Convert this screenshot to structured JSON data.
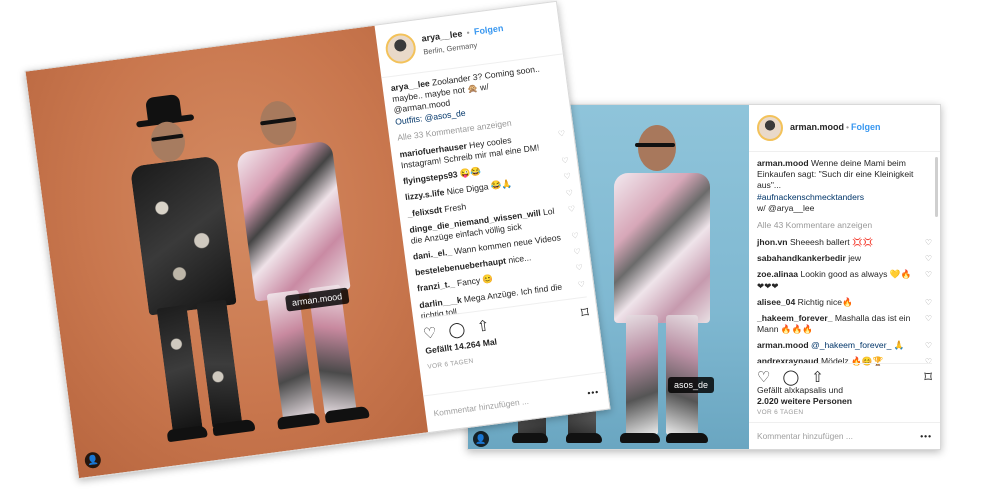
{
  "post2": {
    "username": "arman.mood",
    "follow": "Folgen",
    "dot": "•",
    "photo_tag": "asos_de",
    "comments": [
      {
        "user": "arman.mood",
        "text": "Wenne deine Mami beim Einkaufen sagt: \"Such dir eine Kleinigkeit aus\"..."
      },
      {
        "user": "",
        "text": "#aufnackenschmecktanders"
      },
      {
        "user": "",
        "text": "w/ @arya__lee"
      }
    ],
    "view_all": "Alle 43 Kommentare anzeigen",
    "replies": [
      {
        "user": "jhon.vn",
        "text": "Sheeesh ballert 💢💢"
      },
      {
        "user": "sabahandkankerbedir",
        "text": "jew"
      },
      {
        "user": "zoe.alinaa",
        "text": "Lookin good as always 💛🔥❤❤❤"
      },
      {
        "user": "alisee_04",
        "text": "Richtig nice🔥"
      },
      {
        "user": "_hakeem_forever_",
        "text": "Mashalla das ist ein Mann 🔥🔥🔥"
      },
      {
        "user": "arman.mood",
        "text": "@_hakeem_forever_ 🙏"
      },
      {
        "user": "andrexraynaud",
        "text": "Mödelz 🔥😊🏆"
      }
    ],
    "likes_line1": "Gefällt alxkapsalis und",
    "likes_line2": "2.020 weitere Personen",
    "timestamp": "VOR 6 TAGEN",
    "add_comment": "Kommentar hinzufügen ...",
    "options": "•••"
  },
  "post1": {
    "username": "arya__lee",
    "follow": "Folgen",
    "dot": "•",
    "location": "Berlin, Germany",
    "photo_tag": "arman.mood",
    "caption_user": "arya__lee",
    "caption_text": "Zoolander 3? Coming soon.. maybe.. maybe not 🙊 w/ @arman.mood",
    "caption_outfits": "Outfits: @asos_de",
    "view_all": "Alle 33 Kommentare anzeigen",
    "replies": [
      {
        "user": "mariofuerhauser",
        "text": "Hey cooles Instagram! Schreib mir mal eine DM!"
      },
      {
        "user": "flyingsteps93",
        "text": "😜😂"
      },
      {
        "user": "lizzy.s.life",
        "text": "Nice Digga 😂🙏"
      },
      {
        "user": "_felixsdt",
        "text": "Fresh"
      },
      {
        "user": "dinge_die_niemand_wissen_will",
        "text": "Lol die Anzüge einfach völlig sick"
      },
      {
        "user": "dani._el._",
        "text": "Wann kommen neue Videos"
      },
      {
        "user": "bestelebenueberhaupt",
        "text": "nice..."
      },
      {
        "user": "franzi_t._",
        "text": "Fancy 😊"
      },
      {
        "user": "darlin___k",
        "text": "Mega Anzüge. Ich find die richtig toll."
      }
    ],
    "likes": "Gefällt 14.264 Mal",
    "timestamp": "VOR 6 TAGEN",
    "add_comment": "Kommentar hinzufügen ...",
    "options": "•••"
  },
  "icons": {
    "heart": "♡",
    "comment": "◯",
    "share": "⇧",
    "bookmark": "⌑",
    "user": "👤"
  }
}
